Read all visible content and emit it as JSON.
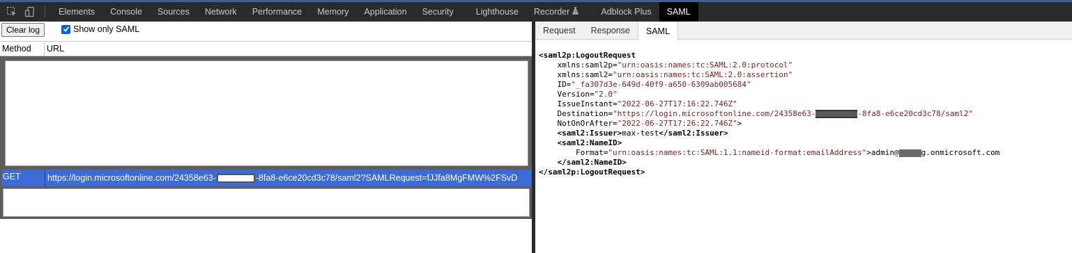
{
  "devtools_tabs": [
    "Elements",
    "Console",
    "Sources",
    "Network",
    "Performance",
    "Memory",
    "Application",
    "Security",
    "Lighthouse",
    "Recorder",
    "Adblock Plus",
    "SAML"
  ],
  "active_devtools_tab": "SAML",
  "left": {
    "clear_log": "Clear log",
    "show_only_saml": "Show only SAML",
    "show_only_saml_checked": true,
    "columns": {
      "method": "Method",
      "url": "URL"
    },
    "selected_request": {
      "method": "GET",
      "url_prefix": "https://login.microsoftonline.com/24358e63-",
      "url_suffix": "-8fa8-e6ce20cd3c78/saml2?SAMLRequest=fJJfa8MgFMW%2FSvD"
    }
  },
  "right": {
    "tabs": [
      "Request",
      "Response",
      "SAML"
    ],
    "active_tab": "SAML",
    "xml": {
      "open_tag": "saml2p:LogoutRequest",
      "attrs": [
        {
          "name": "xmlns:saml2p",
          "value": "\"urn:oasis:names:tc:SAML:2.0:protocol\""
        },
        {
          "name": "xmlns:saml2",
          "value": "\"urn:oasis:names:tc:SAML:2.0:assertion\""
        },
        {
          "name": "ID",
          "value": "\"_fa307d3e-649d-40f9-a650-6309ab005684\""
        },
        {
          "name": "Version",
          "value": "\"2.0\""
        },
        {
          "name": "IssueInstant",
          "value": "\"2022-06-27T17:16:22.746Z\""
        }
      ],
      "destination_name": "Destination",
      "destination_prefix": "\"https://login.microsoftonline.com/24358e63-",
      "destination_suffix": "-8fa8-e6ce20cd3c78/saml2\"",
      "notonorafter_name": "NotOnOrAfter",
      "notonorafter_value": "\"2022-06-27T17:26:22.746Z\"",
      "issuer_tag": "saml2:Issuer",
      "issuer_value": "max-test",
      "nameid_tag": "saml2:NameID",
      "format_name": "Format",
      "format_value": "\"urn:oasis:names:tc:SAML:1.1:nameid-format:emailAddress\"",
      "nameid_prefix": "admin@",
      "nameid_suffix": "g.onmicrosoft.com"
    }
  }
}
